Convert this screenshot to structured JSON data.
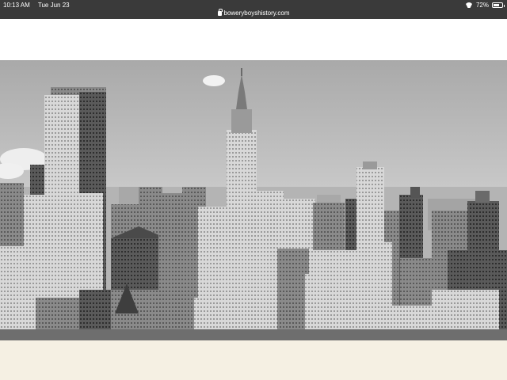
{
  "status_bar": {
    "time": "10:13 AM",
    "date": "Tue Jun 23",
    "url": "boweryboyshistory.com",
    "battery_percent": "72%",
    "battery_level": 0.72,
    "icons": [
      "lock-icon",
      "wifi-icon",
      "battery-icon"
    ]
  },
  "photo": {
    "subject": "skyline-photo",
    "tone": "black-and-white"
  },
  "colors": {
    "status_bar_bg": "#3a3a3a",
    "page_bg": "#f5f0e3",
    "band_bg": "#ffffff"
  }
}
